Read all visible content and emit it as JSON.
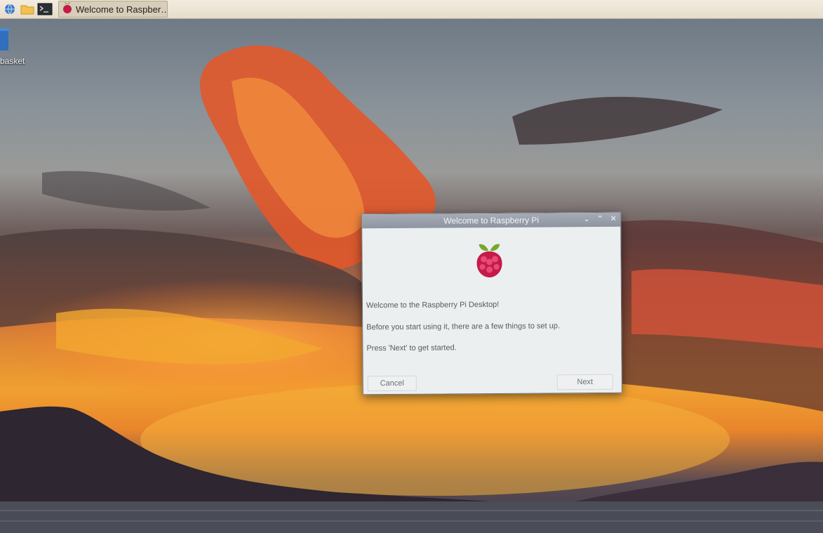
{
  "taskbar": {
    "window_label": "Welcome to Raspber…",
    "icons": [
      "globe-icon",
      "folder-icon",
      "terminal-icon",
      "raspberry-icon"
    ]
  },
  "desktop": {
    "icon_label": "basket"
  },
  "dialog": {
    "title": "Welcome to Raspberry Pi",
    "controls": [
      "minimize",
      "maximize",
      "close"
    ],
    "heading": "Welcome to the Raspberry Pi Desktop!",
    "body_line1": "Before you start using it, there are a few things to set up.",
    "body_line2": "Press 'Next' to get started.",
    "cancel_label": "Cancel",
    "next_label": "Next"
  },
  "colors": {
    "taskbar_bg": "#e6dccb",
    "titlebar_bg": "#9aa0aa",
    "dialog_bg": "#eceff0",
    "raspberry_red": "#c51a4a",
    "leaf_green": "#75a928"
  }
}
